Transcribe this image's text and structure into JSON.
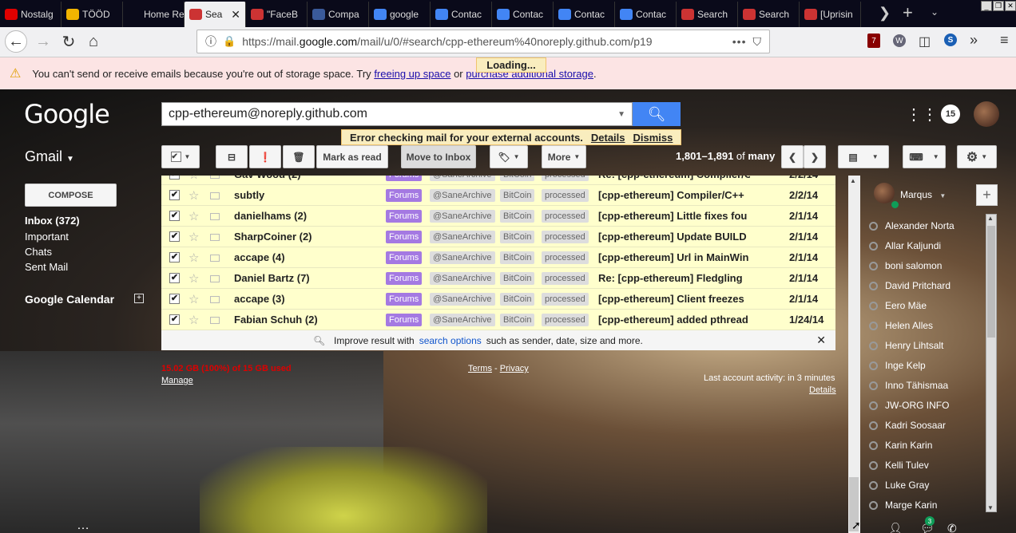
{
  "browser": {
    "tabs": [
      {
        "label": "Nostalg",
        "icon": "youtube-icon",
        "color": "#e00000"
      },
      {
        "label": "TÖÖD",
        "icon": "kb-icon",
        "color": "#f2b400"
      },
      {
        "label": "Home Realm",
        "icon": "",
        "color": ""
      },
      {
        "label": "Sea",
        "icon": "gmail-100-icon",
        "color": "#c33",
        "active": true
      },
      {
        "label": "\"FaceB",
        "icon": "gmail-icon",
        "color": "#c33"
      },
      {
        "label": "Compa",
        "icon": "wordpress-icon",
        "color": "#3a5a9a"
      },
      {
        "label": "google",
        "icon": "google-icon",
        "color": "#4285f4"
      },
      {
        "label": "Contac",
        "icon": "google-icon",
        "color": "#4285f4"
      },
      {
        "label": "Contac",
        "icon": "google-icon",
        "color": "#4285f4"
      },
      {
        "label": "Contac",
        "icon": "google-icon",
        "color": "#4285f4"
      },
      {
        "label": "Contac",
        "icon": "google-icon",
        "color": "#4285f4"
      },
      {
        "label": "Search",
        "icon": "gmail-100-icon",
        "color": "#c33"
      },
      {
        "label": "Search",
        "icon": "gmail-100-icon",
        "color": "#c33"
      },
      {
        "label": "[Uprisin",
        "icon": "gmail-100-icon",
        "color": "#c33"
      }
    ],
    "url_prefix": "https://mail.",
    "url_domain": "google.com",
    "url_rest": "/mail/u/0/#search/cpp-ethereum%40noreply.github.com/p19",
    "ublock_count": "7",
    "loading": "Loading..."
  },
  "banner": {
    "text_before": "You can't send or receive emails because you're out of storage space. Try",
    "link1": "freeing up space",
    "text_mid": "or",
    "link2": "purchase additional storage",
    "text_end": "."
  },
  "header": {
    "logo": "Google",
    "search_value": "cpp-ethereum@noreply.github.com",
    "error_text": "Error checking mail for your external accounts.",
    "error_details": "Details",
    "error_dismiss": "Dismiss",
    "notifications": "15",
    "app_name": "Gmail"
  },
  "toolbar": {
    "mark_as_read": "Mark as read",
    "move_to_inbox": "Move to Inbox",
    "more": "More",
    "range": "1,801–1,891",
    "of": "of",
    "total": "many"
  },
  "nav": {
    "compose": "COMPOSE",
    "items": [
      "Inbox (372)",
      "Important",
      "Chats",
      "Sent Mail"
    ],
    "calendar": "Google Calendar"
  },
  "labels": {
    "l1": "Forums",
    "l2": "@SaneArchive",
    "l3": "BitCoin",
    "l4": "processed"
  },
  "messages": [
    {
      "sender": "Gav Wood (2)",
      "subject": "Re: [cpp-ethereum] Compiler/C++",
      "date": "2/2/14"
    },
    {
      "sender": "subtly",
      "subject": "[cpp-ethereum] Compiler/C++",
      "date": "2/2/14"
    },
    {
      "sender": "danielhams (2)",
      "subject": "[cpp-ethereum] Little fixes fou",
      "date": "2/1/14"
    },
    {
      "sender": "SharpCoiner (2)",
      "subject": "[cpp-ethereum] Update BUILD",
      "date": "2/1/14"
    },
    {
      "sender": "accape (4)",
      "subject": "[cpp-ethereum] Url in MainWin",
      "date": "2/1/14"
    },
    {
      "sender": "Daniel Bartz (7)",
      "subject": "Re: [cpp-ethereum] Fledgling",
      "date": "2/1/14"
    },
    {
      "sender": "accape (3)",
      "subject": "[cpp-ethereum] Client freezes",
      "date": "2/1/14"
    },
    {
      "sender": "Fabian Schuh (2)",
      "subject": "[cpp-ethereum] added pthread",
      "date": "1/24/14"
    }
  ],
  "improve": {
    "before": "Improve result with",
    "link": "search options",
    "after": "such as sender, date, size and more."
  },
  "footer": {
    "storage": "15.02 GB (100%) of 15 GB used",
    "manage": "Manage",
    "terms": "Terms",
    "dash": "-",
    "privacy": "Privacy",
    "activity": "Last account activity: in 3 minutes",
    "details": "Details"
  },
  "chat": {
    "me": "Marqus",
    "contacts": [
      "Alexander Norta",
      "Allar Kaljundi",
      "boni salomon",
      "David Pritchard",
      "Eero Mäe",
      "Helen Alles",
      "Henry Lihtsalt",
      "Inge Kelp",
      "Inno Tähismaa",
      "JW-ORG INFO",
      "Kadri Soosaar",
      "Karin Karin",
      "Kelli Tulev",
      "Luke Gray",
      "Marge Karin"
    ],
    "badge": "3"
  },
  "colors": {
    "accent": "#4285f4",
    "label_forums": "#a479e2",
    "row_bg": "#ffffcc",
    "banner_bg": "#fce4e4"
  }
}
